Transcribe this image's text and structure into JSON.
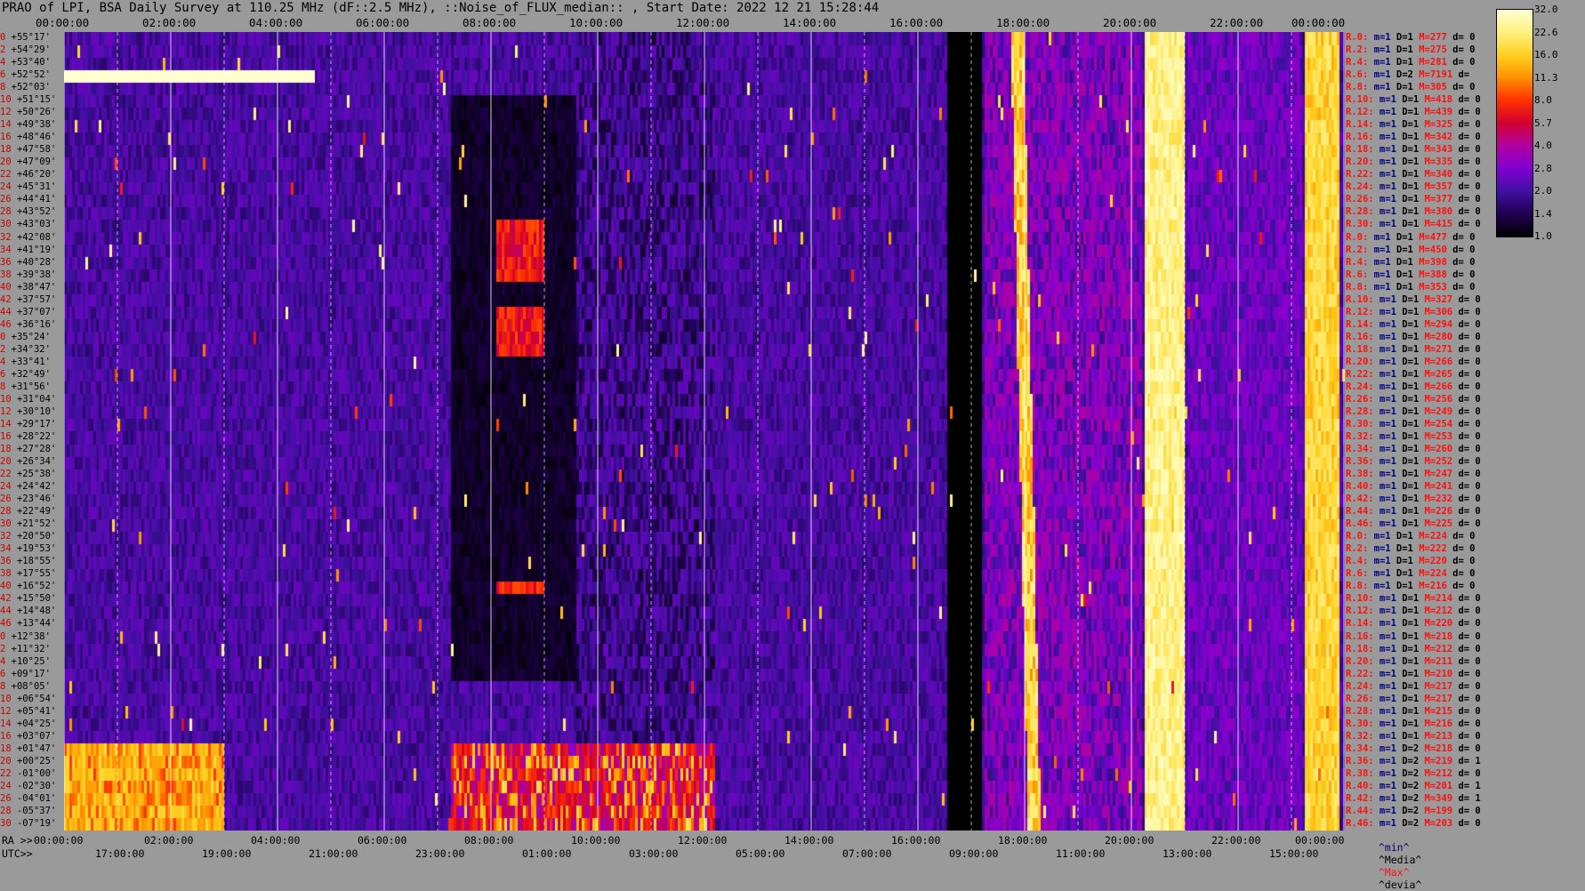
{
  "header": {
    "title": "PRAO of LPI, BSA Daily Survey at 110.25 MHz (dF::2.5 MHz), ::Noise_of_FLUX_median:: , Start Date: 2022 12 21 15:28:44"
  },
  "axes": {
    "top_times": [
      "00:00:00",
      "02:00:00",
      "04:00:00",
      "06:00:00",
      "08:00:00",
      "10:00:00",
      "12:00:00",
      "14:00:00",
      "16:00:00",
      "18:00:00",
      "20:00:00",
      "22:00:00",
      "00:00:00"
    ],
    "ra_prefix": "RA >>",
    "ra_times": [
      "00:00:00",
      "02:00:00",
      "04:00:00",
      "06:00:00",
      "08:00:00",
      "10:00:00",
      "12:00:00",
      "14:00:00",
      "16:00:00",
      "18:00:00",
      "20:00:00",
      "22:00:00",
      "00:00:00"
    ],
    "utc_prefix": "UTC>>",
    "utc_times": [
      "17:00:00",
      "19:00:00",
      "21:00:00",
      "23:00:00",
      "01:00:00",
      "03:00:00",
      "05:00:00",
      "07:00:00",
      "09:00:00",
      "11:00:00",
      "13:00:00",
      "15:00:00"
    ]
  },
  "rows": {
    "indices": [
      "0",
      "2",
      "4",
      "6",
      "8",
      "10",
      "12",
      "14",
      "16",
      "18",
      "20",
      "22",
      "24",
      "26",
      "28",
      "30",
      "32",
      "34",
      "36",
      "38",
      "40",
      "42",
      "44",
      "46",
      "0",
      "2",
      "4",
      "6",
      "8",
      "10",
      "12",
      "14",
      "16",
      "18",
      "20",
      "22",
      "24",
      "26",
      "28",
      "30",
      "32",
      "34",
      "36",
      "38",
      "40",
      "42",
      "44",
      "46",
      "0",
      "2",
      "4",
      "6",
      "8",
      "10",
      "12",
      "14",
      "16",
      "18",
      "20",
      "22",
      "24",
      "26",
      "28",
      "30",
      "32",
      "34",
      "36",
      "38",
      "40",
      "42",
      "44",
      "46"
    ],
    "declinations": [
      "+55°17'",
      "+54°29'",
      "+53°40'",
      "+52°52'",
      "+52°03'",
      "+51°15'",
      "+50°26'",
      "+49°38'",
      "+48°46'",
      "+47°58'",
      "+47°09'",
      "+46°20'",
      "+45°31'",
      "+44°41'",
      "+43°52'",
      "+43°03'",
      "+42°08'",
      "+41°19'",
      "+40°28'",
      "+39°38'",
      "+38°47'",
      "+37°57'",
      "+37°07'",
      "+36°16'",
      "+35°24'",
      "+34°32'",
      "+33°41'",
      "+32°49'",
      "+31°56'",
      "+31°04'",
      "+30°10'",
      "+29°17'",
      "+28°22'",
      "+27°28'",
      "+26°34'",
      "+25°38'",
      "+24°42'",
      "+23°46'",
      "+22°49'",
      "+21°52'",
      "+20°50'",
      "+19°53'",
      "+18°55'",
      "+17°55'",
      "+16°52'",
      "+15°50'",
      "+14°48'",
      "+13°44'",
      "+12°38'",
      "+11°32'",
      "+10°25'",
      "+09°17'",
      "+08°05'",
      "+06°54'",
      "+05°41'",
      "+04°25'",
      "+03°07'",
      "+01°47'",
      "+00°25'",
      "-01°00'",
      "-02°30'",
      "-04°01'",
      "-05°37'",
      "-07°19'"
    ]
  },
  "stats": {
    "rows": [
      [
        "R.0:",
        "1",
        "1",
        "277",
        "0"
      ],
      [
        "R.2:",
        "1",
        "1",
        "275",
        "0"
      ],
      [
        "R.4:",
        "1",
        "1",
        "281",
        "0"
      ],
      [
        "R.6:",
        "1",
        "2",
        "7191",
        ""
      ],
      [
        "R.8:",
        "1",
        "1",
        "305",
        "0"
      ],
      [
        "R.10:",
        "1",
        "1",
        "418",
        "0"
      ],
      [
        "R.12:",
        "1",
        "1",
        "439",
        "0"
      ],
      [
        "R.14:",
        "1",
        "1",
        "325",
        "0"
      ],
      [
        "R.16:",
        "1",
        "1",
        "342",
        "0"
      ],
      [
        "R.18:",
        "1",
        "1",
        "343",
        "0"
      ],
      [
        "R.20:",
        "1",
        "1",
        "335",
        "0"
      ],
      [
        "R.22:",
        "1",
        "1",
        "340",
        "0"
      ],
      [
        "R.24:",
        "1",
        "1",
        "357",
        "0"
      ],
      [
        "R.26:",
        "1",
        "1",
        "377",
        "0"
      ],
      [
        "R.28:",
        "1",
        "1",
        "380",
        "0"
      ],
      [
        "R.30:",
        "1",
        "1",
        "415",
        "0"
      ],
      [
        "R.0:",
        "1",
        "1",
        "477",
        "0"
      ],
      [
        "R.2:",
        "1",
        "1",
        "450",
        "0"
      ],
      [
        "R.4:",
        "1",
        "1",
        "398",
        "0"
      ],
      [
        "R.6:",
        "1",
        "1",
        "388",
        "0"
      ],
      [
        "R.8:",
        "1",
        "1",
        "353",
        "0"
      ],
      [
        "R.10:",
        "1",
        "1",
        "327",
        "0"
      ],
      [
        "R.12:",
        "1",
        "1",
        "306",
        "0"
      ],
      [
        "R.14:",
        "1",
        "1",
        "294",
        "0"
      ],
      [
        "R.16:",
        "1",
        "1",
        "280",
        "0"
      ],
      [
        "R.18:",
        "1",
        "1",
        "271",
        "0"
      ],
      [
        "R.20:",
        "1",
        "1",
        "266",
        "0"
      ],
      [
        "R.22:",
        "1",
        "1",
        "265",
        "0"
      ],
      [
        "R.24:",
        "1",
        "1",
        "266",
        "0"
      ],
      [
        "R.26:",
        "1",
        "1",
        "256",
        "0"
      ],
      [
        "R.28:",
        "1",
        "1",
        "249",
        "0"
      ],
      [
        "R.30:",
        "1",
        "1",
        "254",
        "0"
      ],
      [
        "R.32:",
        "1",
        "1",
        "253",
        "0"
      ],
      [
        "R.34:",
        "1",
        "1",
        "260",
        "0"
      ],
      [
        "R.36:",
        "1",
        "1",
        "252",
        "0"
      ],
      [
        "R.38:",
        "1",
        "1",
        "247",
        "0"
      ],
      [
        "R.40:",
        "1",
        "1",
        "241",
        "0"
      ],
      [
        "R.42:",
        "1",
        "1",
        "232",
        "0"
      ],
      [
        "R.44:",
        "1",
        "1",
        "226",
        "0"
      ],
      [
        "R.46:",
        "1",
        "1",
        "225",
        "0"
      ],
      [
        "R.0:",
        "1",
        "1",
        "224",
        "0"
      ],
      [
        "R.2:",
        "1",
        "1",
        "222",
        "0"
      ],
      [
        "R.4:",
        "1",
        "1",
        "220",
        "0"
      ],
      [
        "R.6:",
        "1",
        "1",
        "224",
        "0"
      ],
      [
        "R.8:",
        "1",
        "1",
        "216",
        "0"
      ],
      [
        "R.10:",
        "1",
        "1",
        "214",
        "0"
      ],
      [
        "R.12:",
        "1",
        "1",
        "212",
        "0"
      ],
      [
        "R.14:",
        "1",
        "1",
        "220",
        "0"
      ],
      [
        "R.16:",
        "1",
        "1",
        "218",
        "0"
      ],
      [
        "R.18:",
        "1",
        "1",
        "212",
        "0"
      ],
      [
        "R.20:",
        "1",
        "1",
        "211",
        "0"
      ],
      [
        "R.22:",
        "1",
        "1",
        "210",
        "0"
      ],
      [
        "R.24:",
        "1",
        "1",
        "217",
        "0"
      ],
      [
        "R.26:",
        "1",
        "1",
        "217",
        "0"
      ],
      [
        "R.28:",
        "1",
        "1",
        "215",
        "0"
      ],
      [
        "R.30:",
        "1",
        "1",
        "216",
        "0"
      ],
      [
        "R.32:",
        "1",
        "1",
        "213",
        "0"
      ],
      [
        "R.34:",
        "1",
        "2",
        "218",
        "0"
      ],
      [
        "R.36:",
        "1",
        "2",
        "219",
        "1"
      ],
      [
        "R.38:",
        "1",
        "2",
        "212",
        "0"
      ],
      [
        "R.40:",
        "1",
        "2",
        "201",
        "1"
      ],
      [
        "R.42:",
        "1",
        "2",
        "349",
        "1"
      ],
      [
        "R.44:",
        "1",
        "2",
        "199",
        "0"
      ],
      [
        "R.46:",
        "1",
        "2",
        "203",
        "0"
      ]
    ],
    "footer": {
      "min": "^min^",
      "median": "^Media^",
      "max": "^Max^",
      "dev": "^devia^"
    }
  },
  "colorbar": {
    "labels": [
      "32.0",
      "22.6",
      "16.0",
      "11.3",
      "8.0",
      "5.7",
      "4.0",
      "2.8",
      "2.0",
      "1.4",
      "1.0"
    ],
    "colors": [
      "#ffffd0",
      "#fff080",
      "#ffd020",
      "#ff9000",
      "#ff3000",
      "#d00030",
      "#b000a0",
      "#8000d0",
      "#4010a0",
      "#200050",
      "#000000"
    ]
  },
  "chart_data": {
    "type": "heatmap",
    "title": "PRAO of LPI, BSA Daily Survey at 110.25 MHz (dF::2.5 MHz), ::Noise_of_FLUX_median:: , Start Date: 2022 12 21 15:28:44",
    "xlabel": "RA / UTC",
    "ylabel": "",
    "x_ticks_sidereal": [
      "00:00:00",
      "02:00:00",
      "04:00:00",
      "06:00:00",
      "08:00:00",
      "10:00:00",
      "12:00:00",
      "14:00:00",
      "16:00:00",
      "18:00:00",
      "20:00:00",
      "22:00:00",
      "00:00:00"
    ],
    "x_ticks_utc": [
      "17:00:00",
      "19:00:00",
      "21:00:00",
      "23:00:00",
      "01:00:00",
      "03:00:00",
      "05:00:00",
      "07:00:00",
      "09:00:00",
      "11:00:00",
      "13:00:00",
      "15:00:00"
    ],
    "x_range_hours": [
      0,
      24
    ],
    "row_count": 64,
    "dec_range": [
      "+55°17'",
      "-07°19'"
    ],
    "color_scale": [
      1.0,
      32.0
    ],
    "color_scale_labels": [
      "1.0",
      "1.4",
      "2.0",
      "2.8",
      "4.0",
      "5.7",
      "8.0",
      "11.3",
      "16.0",
      "22.6",
      "32.0"
    ],
    "features": [
      {
        "name": "saturated band",
        "ra_hours": [
          20.2,
          21.0
        ],
        "level": 32.0
      },
      {
        "name": "saturated band",
        "ra_hours": [
          23.2,
          23.9
        ],
        "level": 22.6
      },
      {
        "name": "blank gap",
        "ra_hours": [
          16.5,
          17.2
        ],
        "level": 1.0
      },
      {
        "name": "bright row R.6",
        "ra_hours": [
          0.0,
          4.7
        ],
        "level": 32.0
      }
    ]
  }
}
